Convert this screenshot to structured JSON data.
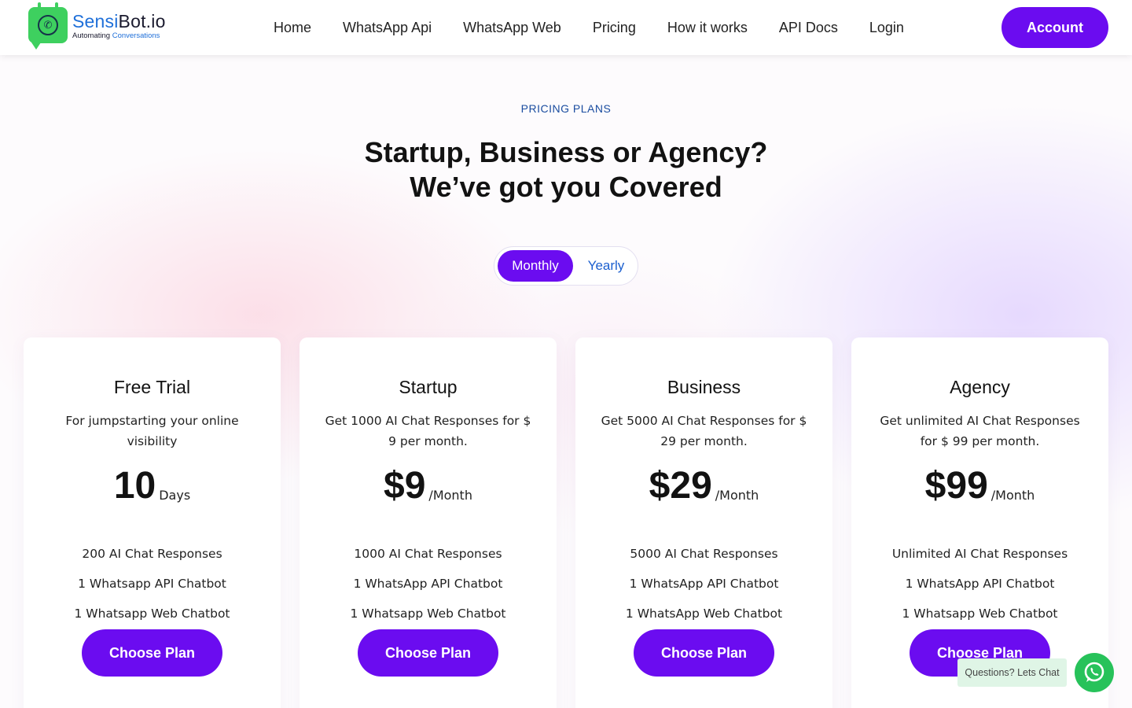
{
  "brand": {
    "name_part1": "Sensi",
    "name_part2": "Bot.io",
    "tagline_part1": "Automating ",
    "tagline_part2": "Conversations"
  },
  "nav": {
    "items": [
      {
        "label": "Home"
      },
      {
        "label": "WhatsApp Api"
      },
      {
        "label": "WhatsApp Web"
      },
      {
        "label": "Pricing"
      },
      {
        "label": "How it works"
      },
      {
        "label": "API Docs"
      },
      {
        "label": "Login"
      }
    ],
    "account_label": "Account"
  },
  "hero": {
    "eyebrow": "PRICING PLANS",
    "headline_line1": "Startup, Business or Agency?",
    "headline_line2": "We’ve got you Covered"
  },
  "billing_toggle": {
    "options": [
      "Monthly",
      "Yearly"
    ],
    "selected": "Monthly"
  },
  "plans": [
    {
      "title": "Free Trial",
      "description": "For jumpstarting your online visibility",
      "amount": "10",
      "unit": "Days",
      "features": [
        "200 AI Chat Responses",
        "1 Whatsapp API Chatbot",
        "1 Whatsapp Web Chatbot"
      ],
      "cta": "Choose Plan"
    },
    {
      "title": "Startup",
      "description": "Get 1000 AI Chat Responses for $ 9 per month.",
      "amount": "$9",
      "unit": "/Month",
      "features": [
        "1000 AI Chat Responses",
        "1 WhatsApp API Chatbot",
        "1 Whatsapp Web Chatbot"
      ],
      "cta": "Choose Plan"
    },
    {
      "title": "Business",
      "description": "Get 5000 AI Chat Responses for $ 29 per month.",
      "amount": "$29",
      "unit": "/Month",
      "features": [
        "5000 AI Chat Responses",
        "1 WhatsApp API Chatbot",
        "1 WhatsApp Web Chatbot"
      ],
      "cta": "Choose Plan"
    },
    {
      "title": "Agency",
      "description": "Get unlimited AI Chat Responses for $ 99 per month.",
      "amount": "$99",
      "unit": "/Month",
      "features": [
        "Unlimited AI Chat Responses",
        "1 WhatsApp API Chatbot",
        "1 Whatsapp Web Chatbot"
      ],
      "cta": "Choose Plan"
    }
  ],
  "chat_widget": {
    "label": "Questions? Lets Chat",
    "icon": "whatsapp-icon"
  },
  "colors": {
    "primary": "#6b0cf0",
    "link_blue": "#1b5fcf",
    "whatsapp_green": "#27c25a"
  }
}
